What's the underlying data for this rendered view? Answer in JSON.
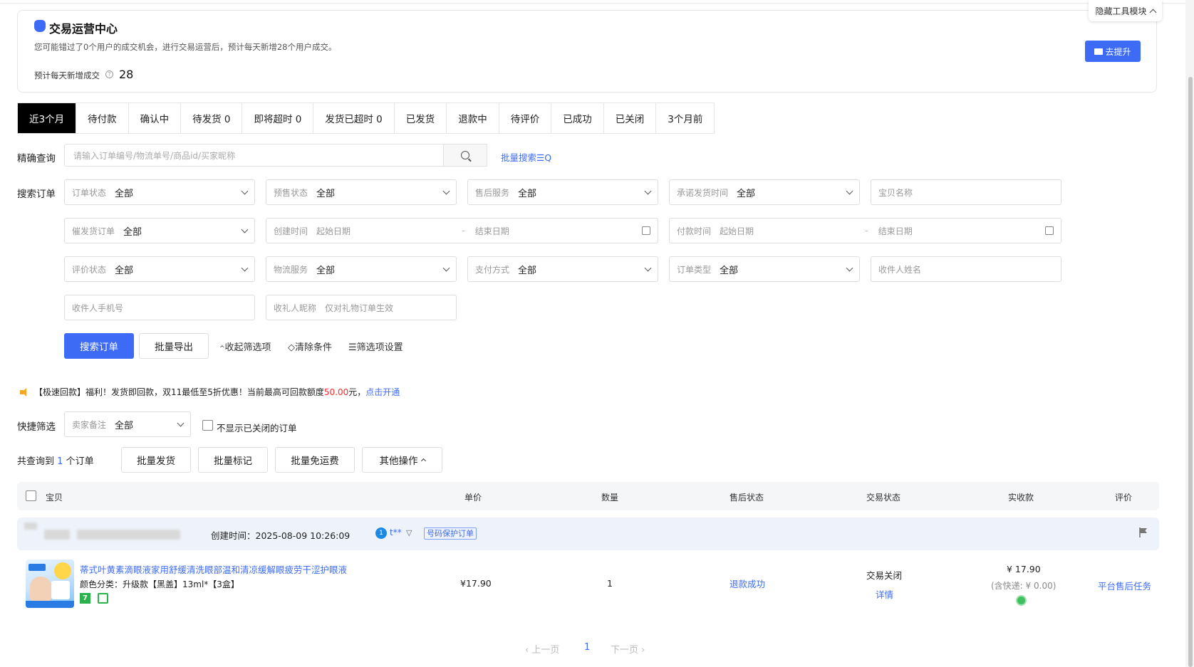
{
  "banner": {
    "title": "交易运营中心",
    "description": "您可能错过了0个用户的成交机会，进行交易运营后，预计每天新增28个用户成交。",
    "stat_label": "预计每天新增成交",
    "stat_value": "28",
    "boost_button": "去提升",
    "hide_tool": "隐藏工具模块"
  },
  "tabs": [
    {
      "label": "近3个月",
      "active": true
    },
    {
      "label": "待付款"
    },
    {
      "label": "确认中"
    },
    {
      "label": "待发货 0"
    },
    {
      "label": "即将超时 0"
    },
    {
      "label": "发货已超时 0"
    },
    {
      "label": "已发货"
    },
    {
      "label": "退款中"
    },
    {
      "label": "待评价"
    },
    {
      "label": "已成功"
    },
    {
      "label": "已关闭"
    },
    {
      "label": "3个月前"
    }
  ],
  "precise": {
    "label": "精确查询",
    "placeholder": "请输入订单编号/物流单号/商品id/买家昵称",
    "batch_search": "批量搜索"
  },
  "search_label": "搜索订单",
  "filters": {
    "order_status": {
      "label": "订单状态",
      "value": "全部"
    },
    "presale_status": {
      "label": "预售状态",
      "value": "全部"
    },
    "after_sale": {
      "label": "售后服务",
      "value": "全部"
    },
    "promise_time": {
      "label": "承诺发货时间",
      "value": "全部"
    },
    "item_name": {
      "placeholder": "宝贝名称"
    },
    "urge_order": {
      "label": "催发货订单",
      "value": "全部"
    },
    "create_time": {
      "label": "创建时间",
      "start": "起始日期",
      "end": "结束日期"
    },
    "pay_time": {
      "label": "付款时间",
      "start": "起始日期",
      "end": "结束日期"
    },
    "review_status": {
      "label": "评价状态",
      "value": "全部"
    },
    "logistics": {
      "label": "物流服务",
      "value": "全部"
    },
    "pay_method": {
      "label": "支付方式",
      "value": "全部"
    },
    "order_type": {
      "label": "订单类型",
      "value": "全部"
    },
    "receiver_name": {
      "placeholder": "收件人姓名"
    },
    "receiver_phone": {
      "placeholder": "收件人手机号"
    },
    "gift_nick": {
      "label": "收礼人昵称",
      "placeholder": "仅对礼物订单生效"
    }
  },
  "actions": {
    "search": "搜索订单",
    "export": "批量导出",
    "collapse": "收起筛选项",
    "clear": "清除条件",
    "settings": "筛选项设置"
  },
  "notice": {
    "prefix": "【极速回款】福利！发货即回款，双11最低至5折优惠！当前最高可回款额度",
    "amount": "50.00",
    "suffix": "元，",
    "link": "点击开通"
  },
  "quick": {
    "label": "快捷筛选",
    "remark_label": "卖家备注",
    "remark_value": "全部",
    "hide_closed": "不显示已关闭的订单"
  },
  "result": {
    "prefix": "共查询到",
    "count": "1",
    "suffix": "个订单",
    "batch_ship": "批量发货",
    "batch_mark": "批量标记",
    "batch_free": "批量免运费",
    "other": "其他操作"
  },
  "table": {
    "headers": [
      "宝贝",
      "单价",
      "数量",
      "售后状态",
      "交易状态",
      "实收款",
      "评价"
    ]
  },
  "order": {
    "created": "创建时间：2025-08-09 10:26:09",
    "buyer": "t**",
    "protect_tag": "号码保护订单",
    "title": "蒂式叶黄素滴眼液家用舒缓清洗眼部温和清凉缓解眼疲劳干涩护眼液",
    "sku": "颜色分类：升级款【黑盖】13ml*【3盒】",
    "badge_number": "7",
    "unit_price": "¥17.90",
    "quantity": "1",
    "after_sale": "退款成功",
    "trade_status": "交易关闭",
    "detail": "详情",
    "amount": "¥ 17.90",
    "shipping_note": "(含快递: ¥ 0.00)",
    "review": "平台售后任务"
  },
  "pager": {
    "prev": "上一页",
    "current": "1",
    "next": "下一页"
  }
}
